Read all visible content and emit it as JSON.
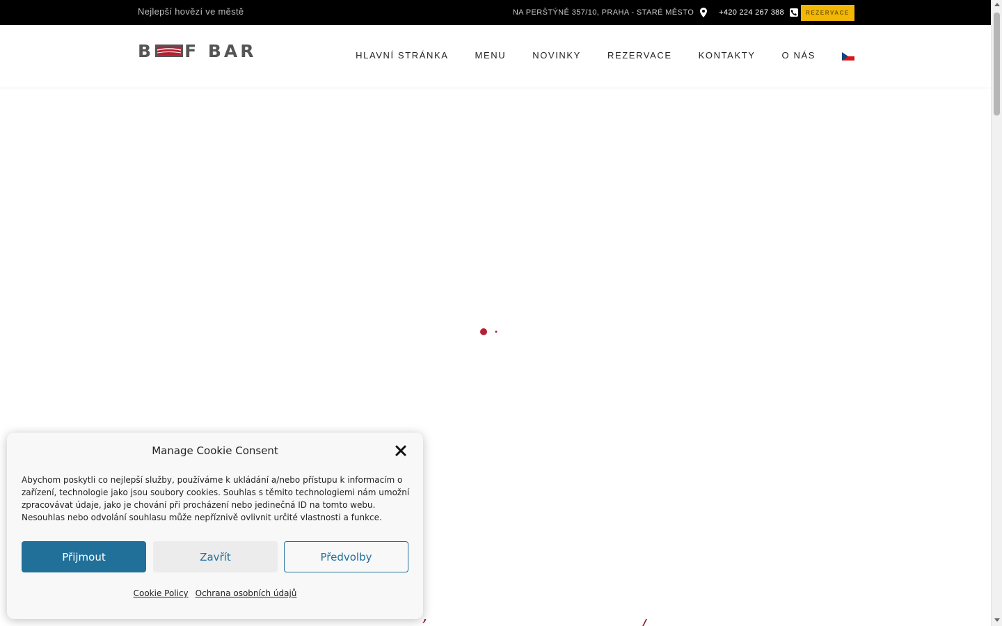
{
  "topbar": {
    "tagline": "Nejlepší hovězí ve městě",
    "address": "NA PERŠTÝNĚ 357/10, PRAHA - STARÉ MĚSTO",
    "phone": "+420 224 267 388",
    "reserve_label": "REZERVACE",
    "reserve_color": "#f2b705"
  },
  "header": {
    "logo_left": "B",
    "logo_right": "F BAR",
    "nav": [
      {
        "label": "HLAVNÍ STRÁNKA"
      },
      {
        "label": "MENU"
      },
      {
        "label": "NOVINKY"
      },
      {
        "label": "REZERVACE"
      },
      {
        "label": "KONTAKTY"
      },
      {
        "label": "O NÁS"
      }
    ],
    "language_icon": "czech-flag-icon"
  },
  "cookie": {
    "title": "Manage Cookie Consent",
    "text": "Abychom poskytli co nejlepší služby, používáme k ukládání a/nebo přístupu k informacím o zařízení, technologie jako jsou soubory cookies. Souhlas s těmito technologiemi nám umožní zpracovávat údaje, jako je chování při procházení nebo jedinečná ID na tomto webu. Nesouhlas nebo odvolání souhlasu může nepříznivě ovlivnit určité vlastnosti a funkce.",
    "accept": "Přijmout",
    "close": "Zavřít",
    "preferences": "Předvolby",
    "link_policy": "Cookie Policy",
    "link_privacy": "Ochrana osobních údajů",
    "accent_color": "#21709a"
  },
  "colors": {
    "brand_red": "#b22234",
    "topbar_bg": "#000000"
  }
}
